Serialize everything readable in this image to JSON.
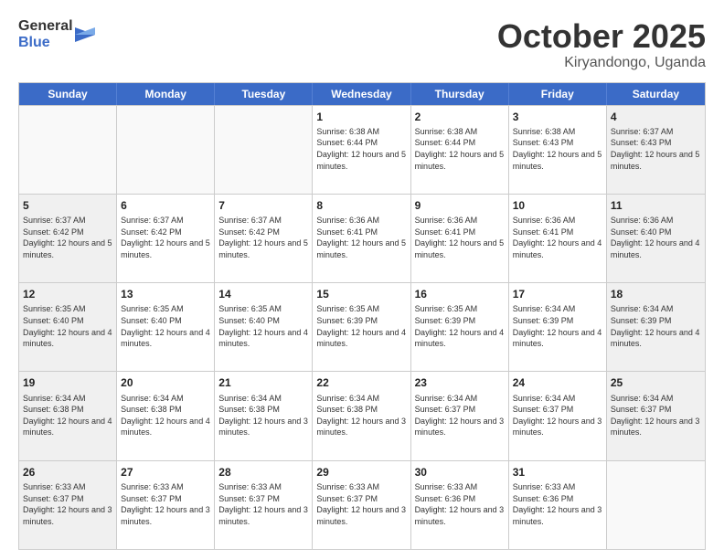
{
  "logo": {
    "line1": "General",
    "line2": "Blue"
  },
  "title": "October 2025",
  "subtitle": "Kiryandongo, Uganda",
  "header": {
    "days": [
      "Sunday",
      "Monday",
      "Tuesday",
      "Wednesday",
      "Thursday",
      "Friday",
      "Saturday"
    ]
  },
  "weeks": [
    [
      {
        "day": "",
        "info": ""
      },
      {
        "day": "",
        "info": ""
      },
      {
        "day": "",
        "info": ""
      },
      {
        "day": "1",
        "info": "Sunrise: 6:38 AM\nSunset: 6:44 PM\nDaylight: 12 hours\nand 5 minutes."
      },
      {
        "day": "2",
        "info": "Sunrise: 6:38 AM\nSunset: 6:44 PM\nDaylight: 12 hours\nand 5 minutes."
      },
      {
        "day": "3",
        "info": "Sunrise: 6:38 AM\nSunset: 6:43 PM\nDaylight: 12 hours\nand 5 minutes."
      },
      {
        "day": "4",
        "info": "Sunrise: 6:37 AM\nSunset: 6:43 PM\nDaylight: 12 hours\nand 5 minutes."
      }
    ],
    [
      {
        "day": "5",
        "info": "Sunrise: 6:37 AM\nSunset: 6:42 PM\nDaylight: 12 hours\nand 5 minutes."
      },
      {
        "day": "6",
        "info": "Sunrise: 6:37 AM\nSunset: 6:42 PM\nDaylight: 12 hours\nand 5 minutes."
      },
      {
        "day": "7",
        "info": "Sunrise: 6:37 AM\nSunset: 6:42 PM\nDaylight: 12 hours\nand 5 minutes."
      },
      {
        "day": "8",
        "info": "Sunrise: 6:36 AM\nSunset: 6:41 PM\nDaylight: 12 hours\nand 5 minutes."
      },
      {
        "day": "9",
        "info": "Sunrise: 6:36 AM\nSunset: 6:41 PM\nDaylight: 12 hours\nand 5 minutes."
      },
      {
        "day": "10",
        "info": "Sunrise: 6:36 AM\nSunset: 6:41 PM\nDaylight: 12 hours\nand 4 minutes."
      },
      {
        "day": "11",
        "info": "Sunrise: 6:36 AM\nSunset: 6:40 PM\nDaylight: 12 hours\nand 4 minutes."
      }
    ],
    [
      {
        "day": "12",
        "info": "Sunrise: 6:35 AM\nSunset: 6:40 PM\nDaylight: 12 hours\nand 4 minutes."
      },
      {
        "day": "13",
        "info": "Sunrise: 6:35 AM\nSunset: 6:40 PM\nDaylight: 12 hours\nand 4 minutes."
      },
      {
        "day": "14",
        "info": "Sunrise: 6:35 AM\nSunset: 6:40 PM\nDaylight: 12 hours\nand 4 minutes."
      },
      {
        "day": "15",
        "info": "Sunrise: 6:35 AM\nSunset: 6:39 PM\nDaylight: 12 hours\nand 4 minutes."
      },
      {
        "day": "16",
        "info": "Sunrise: 6:35 AM\nSunset: 6:39 PM\nDaylight: 12 hours\nand 4 minutes."
      },
      {
        "day": "17",
        "info": "Sunrise: 6:34 AM\nSunset: 6:39 PM\nDaylight: 12 hours\nand 4 minutes."
      },
      {
        "day": "18",
        "info": "Sunrise: 6:34 AM\nSunset: 6:39 PM\nDaylight: 12 hours\nand 4 minutes."
      }
    ],
    [
      {
        "day": "19",
        "info": "Sunrise: 6:34 AM\nSunset: 6:38 PM\nDaylight: 12 hours\nand 4 minutes."
      },
      {
        "day": "20",
        "info": "Sunrise: 6:34 AM\nSunset: 6:38 PM\nDaylight: 12 hours\nand 4 minutes."
      },
      {
        "day": "21",
        "info": "Sunrise: 6:34 AM\nSunset: 6:38 PM\nDaylight: 12 hours\nand 3 minutes."
      },
      {
        "day": "22",
        "info": "Sunrise: 6:34 AM\nSunset: 6:38 PM\nDaylight: 12 hours\nand 3 minutes."
      },
      {
        "day": "23",
        "info": "Sunrise: 6:34 AM\nSunset: 6:37 PM\nDaylight: 12 hours\nand 3 minutes."
      },
      {
        "day": "24",
        "info": "Sunrise: 6:34 AM\nSunset: 6:37 PM\nDaylight: 12 hours\nand 3 minutes."
      },
      {
        "day": "25",
        "info": "Sunrise: 6:34 AM\nSunset: 6:37 PM\nDaylight: 12 hours\nand 3 minutes."
      }
    ],
    [
      {
        "day": "26",
        "info": "Sunrise: 6:33 AM\nSunset: 6:37 PM\nDaylight: 12 hours\nand 3 minutes."
      },
      {
        "day": "27",
        "info": "Sunrise: 6:33 AM\nSunset: 6:37 PM\nDaylight: 12 hours\nand 3 minutes."
      },
      {
        "day": "28",
        "info": "Sunrise: 6:33 AM\nSunset: 6:37 PM\nDaylight: 12 hours\nand 3 minutes."
      },
      {
        "day": "29",
        "info": "Sunrise: 6:33 AM\nSunset: 6:37 PM\nDaylight: 12 hours\nand 3 minutes."
      },
      {
        "day": "30",
        "info": "Sunrise: 6:33 AM\nSunset: 6:36 PM\nDaylight: 12 hours\nand 3 minutes."
      },
      {
        "day": "31",
        "info": "Sunrise: 6:33 AM\nSunset: 6:36 PM\nDaylight: 12 hours\nand 3 minutes."
      },
      {
        "day": "",
        "info": ""
      }
    ]
  ]
}
